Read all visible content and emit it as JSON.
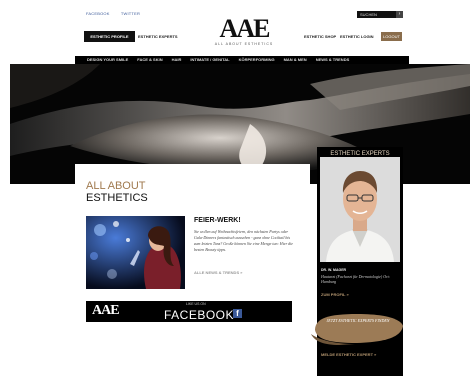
{
  "topbar": {
    "facebook_label": "FACEBOOK",
    "twitter_label": "TWITTER",
    "search_label": "SUCHEN"
  },
  "header": {
    "tab_profile": "ESTHETIC PROFILE",
    "tab_experts": "ESTHETIC EXPERTS",
    "logo": "AAE",
    "tagline": "ALL ABOUT ESTHETICS",
    "shop": "ESTHETIC SHOP",
    "login": "ESTHETIC LOGIN",
    "logout": "LOGOUT"
  },
  "nav": {
    "items": [
      "DESIGN YOUR SMILE",
      "FACE & SKIN",
      "HAIR",
      "INTIMATE / GENITAL",
      "KÖRPERFORMING",
      "MAN & MEN",
      "NEWS & TRENDS"
    ]
  },
  "main": {
    "heading_line1": "ALL ABOUT",
    "heading_line2": "ESTHETICS",
    "article": {
      "title": "FEIER-WERK!",
      "body": "Sie wollen auf Weihnachtsfeiern, den nächsten Partys oder Gala-Dinners fantastisch aussehen - ganz ohne Cocktail bis zum letzten Tanz? Große können Sie eine Menge tun: Hier die besten Beauty tipps.",
      "link": "ALLE NEWS & TRENDS »"
    },
    "facebook_banner": {
      "logo": "AAE",
      "like_text": "LIKE US ON",
      "word": "FACEBOOK",
      "icon_letter": "f"
    }
  },
  "sidebar": {
    "title": "ESTHETIC EXPERTS",
    "doctor_name": "DR. W. MAGER",
    "doctor_desc": "Hautarzt (Facharzt für Dermatologie) Ort: Hamburg",
    "profile_link": "ZUM PROFIL »",
    "cta_text": "JETZT ESTHETIC EXPERTS FINDEN",
    "expert_link": "MELDE ESTHETIC EXPERT »"
  },
  "colors": {
    "accent_gold": "#a07a4f",
    "nav_bg": "#000000",
    "facebook_blue": "#3b5998"
  }
}
